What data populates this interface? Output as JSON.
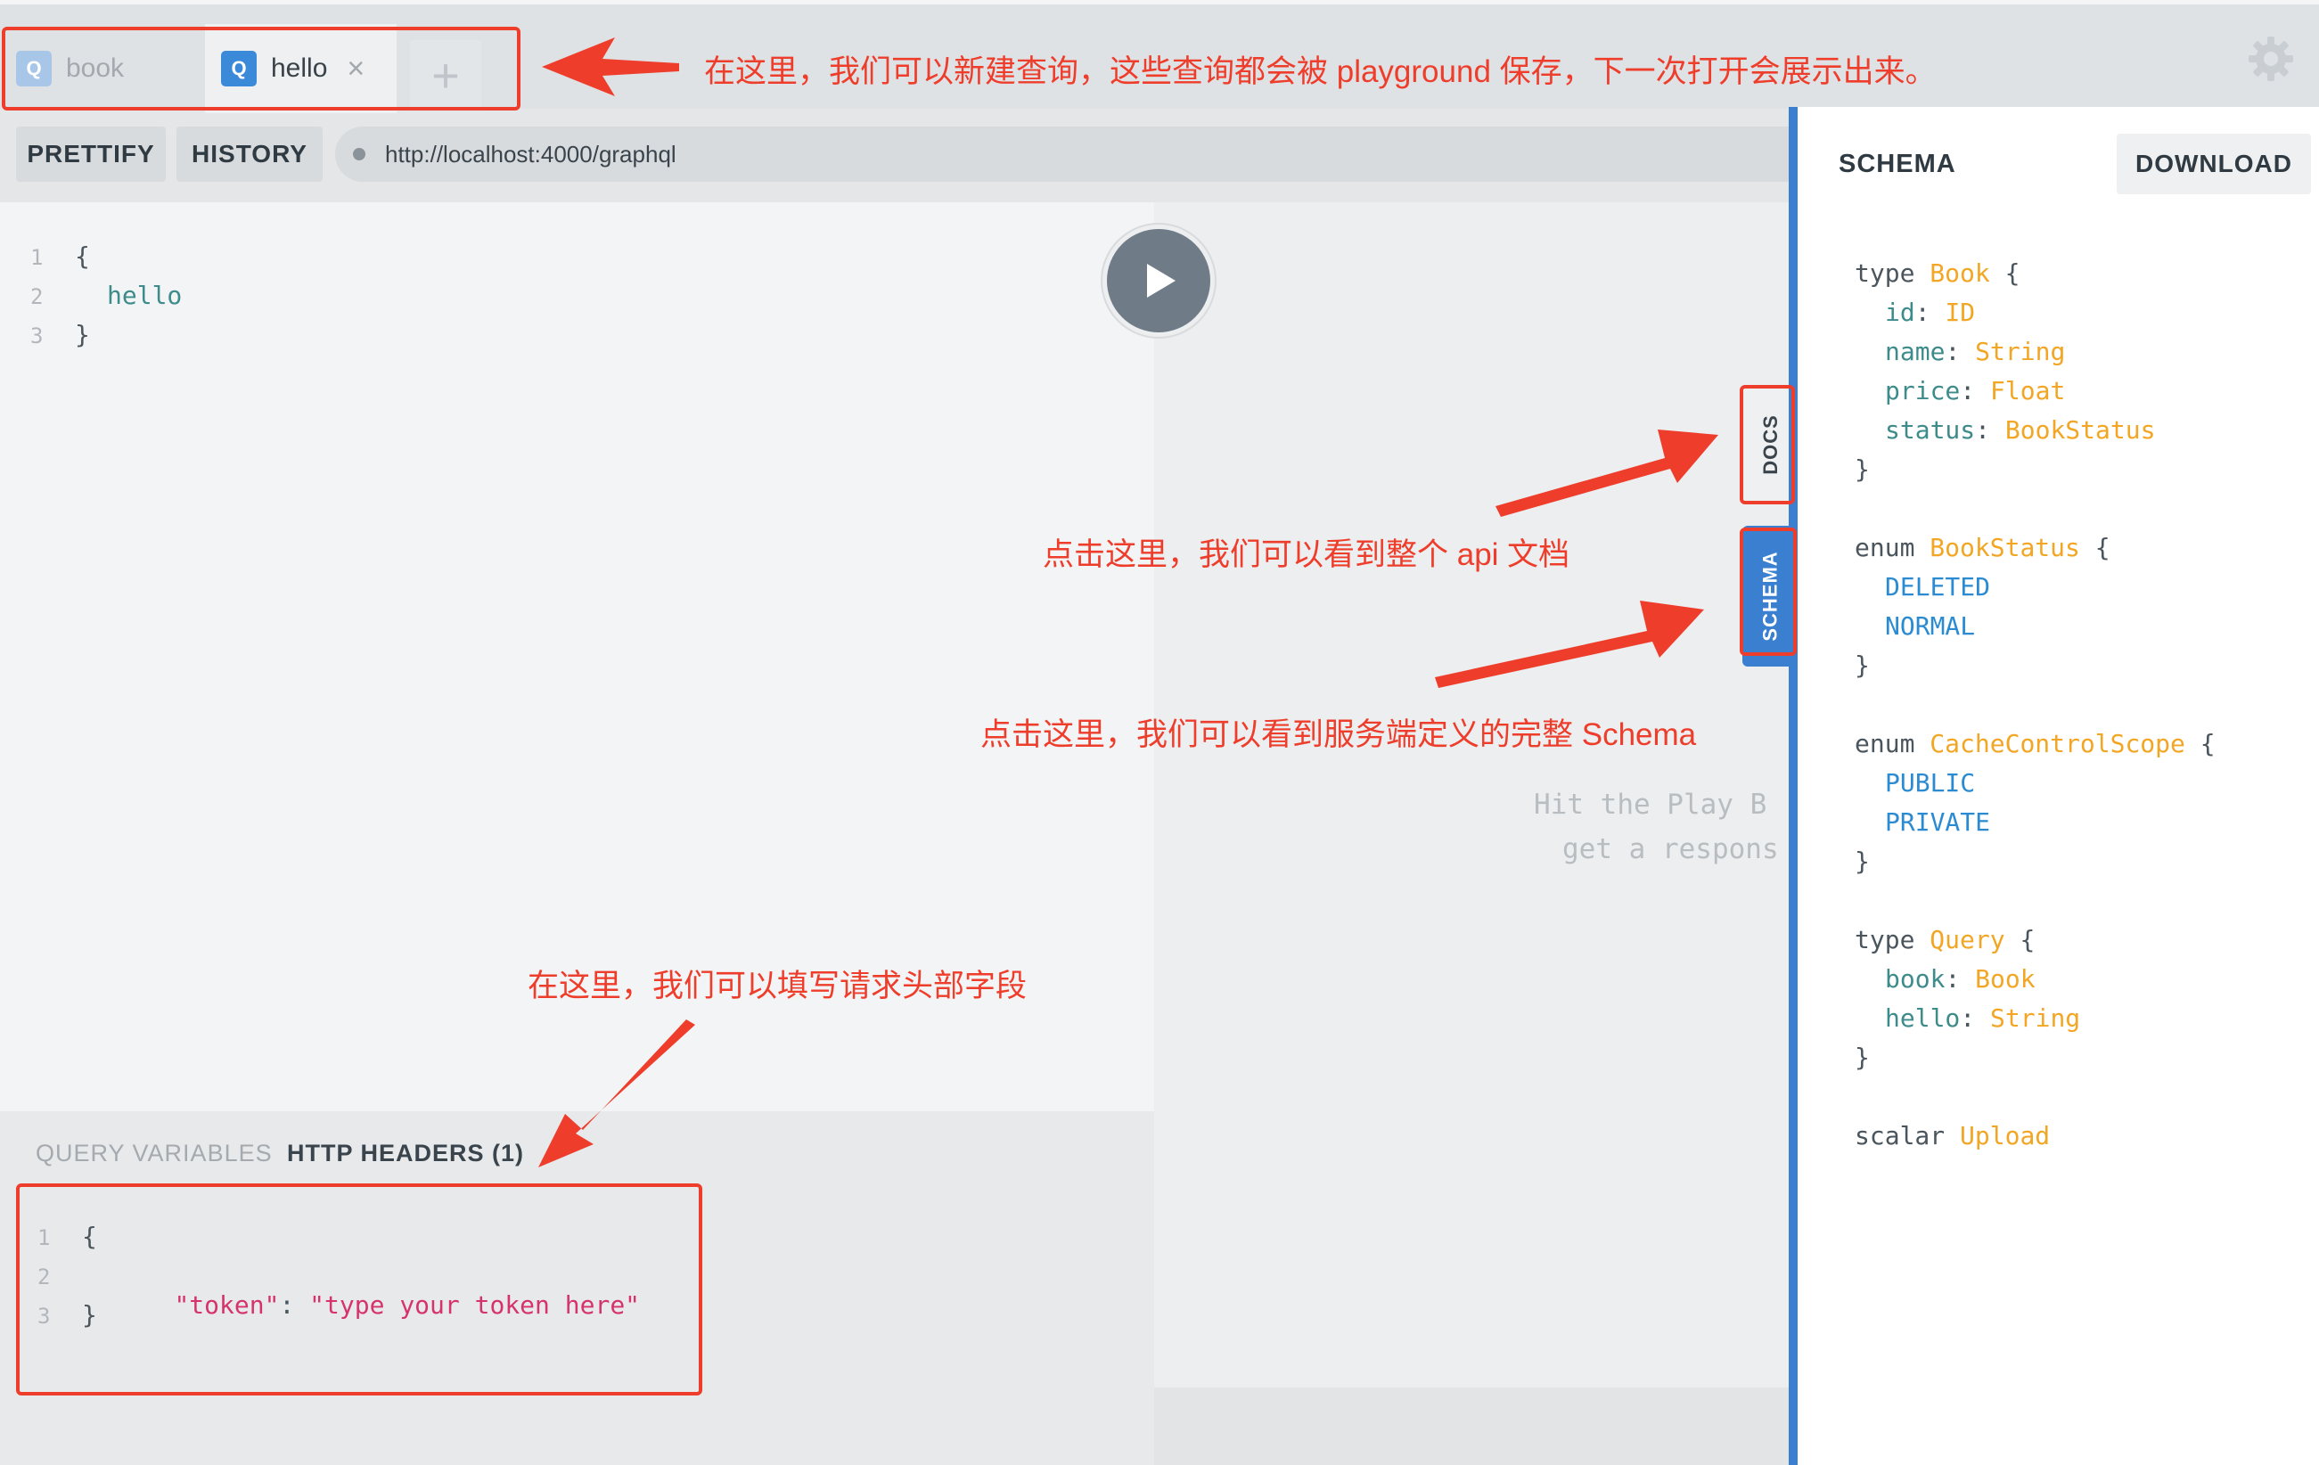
{
  "tabs": [
    {
      "badge": "Q",
      "label": "book"
    },
    {
      "badge": "Q",
      "label": "hello",
      "close": "×"
    }
  ],
  "add_tab_label": "+",
  "toolbar": {
    "prettify": "PRETTIFY",
    "history": "HISTORY",
    "endpoint": "http://localhost:4000/graphql"
  },
  "query_editor": {
    "line_numbers": [
      "1",
      "2",
      "3"
    ],
    "lines": [
      "{",
      "hello",
      "}"
    ]
  },
  "result_placeholder": [
    "Hit the Play B",
    "get a respons"
  ],
  "bottom_panel": {
    "tab_variables": "QUERY VARIABLES",
    "tab_headers": "HTTP HEADERS (1)",
    "line_numbers": [
      "1",
      "2",
      "3"
    ],
    "open_brace": "{",
    "key": "\"token\"",
    "colon": ":",
    "value": "\"type your token here\"",
    "close_brace": "}"
  },
  "side_tabs": {
    "docs": "DOCS",
    "schema": "SCHEMA"
  },
  "schema_panel": {
    "title": "SCHEMA",
    "download": "DOWNLOAD",
    "types": [
      {
        "keyword": "type",
        "name": "Book",
        "fields": [
          {
            "name": "id",
            "type": "ID"
          },
          {
            "name": "name",
            "type": "String"
          },
          {
            "name": "price",
            "type": "Float"
          },
          {
            "name": "status",
            "type": "BookStatus"
          }
        ]
      },
      {
        "keyword": "enum",
        "name": "BookStatus",
        "values": [
          "DELETED",
          "NORMAL"
        ]
      },
      {
        "keyword": "enum",
        "name": "CacheControlScope",
        "values": [
          "PUBLIC",
          "PRIVATE"
        ]
      },
      {
        "keyword": "type",
        "name": "Query",
        "fields": [
          {
            "name": "book",
            "type": "Book"
          },
          {
            "name": "hello",
            "type": "String"
          }
        ]
      }
    ],
    "scalar_keyword": "scalar",
    "scalar_name": "Upload"
  },
  "annotations": {
    "tabs": "在这里，我们可以新建查询，这些查询都会被 playground 保存，下一次打开会展示出来。",
    "docs": "点击这里，我们可以看到整个 api 文档",
    "schema": "点击这里，我们可以看到服务端定义的完整 Schema",
    "headers": "在这里，我们可以填写请求头部字段"
  },
  "colors": {
    "annotation": "#ee3d2b",
    "accent": "#3b7fd1",
    "type_name": "#f2a623",
    "field": "#3e8b8b",
    "enum_value": "#2a8bd3",
    "string": "#d6336c"
  },
  "icons": {
    "settings": "gear-icon",
    "play": "play-icon",
    "close": "close-icon",
    "add": "plus-icon"
  }
}
